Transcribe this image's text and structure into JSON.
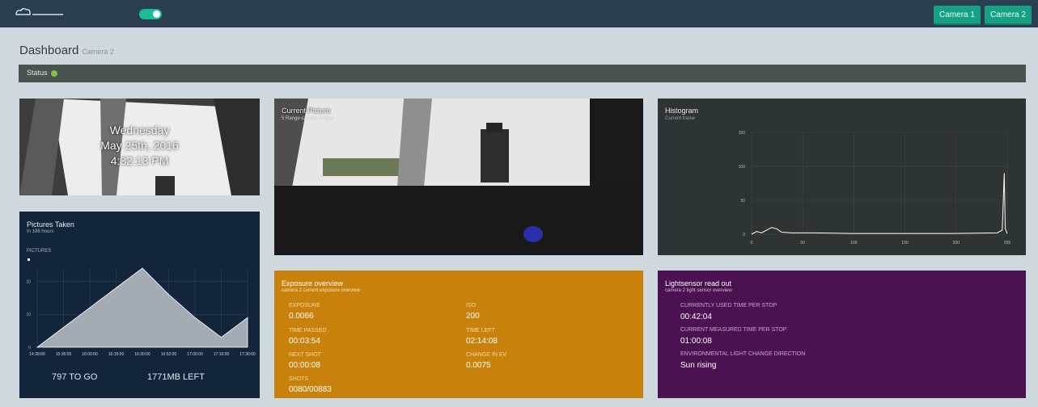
{
  "colors": {
    "topbar": "#2b3e50",
    "accent": "#1abc9c",
    "status_ok": "#7fc144",
    "exposure_bg": "#c8820c",
    "light_bg": "#4b1150",
    "pictures_bg": "#13253b",
    "histogram_bg": "#2e3333"
  },
  "header": {
    "logo_icon": "cloud-logo-icon",
    "toggle_state": "on",
    "camera1_label": "Camera 1",
    "camera2_label": "Camera 2"
  },
  "page": {
    "title": "Dashboard",
    "subtitle": "Camera 2"
  },
  "status": {
    "label": "Status"
  },
  "clock": {
    "day": "Wednesday",
    "date": "May 25th, 2016",
    "time": "4:32:13 PM"
  },
  "pictures": {
    "title": "Pictures Taken",
    "subtitle": "In 186 hours",
    "legend": "PICTURES",
    "remaining": "797 TO GO",
    "disk": "1771MB LEFT",
    "chart_data": {
      "type": "area",
      "x": [
        "14:28:00",
        "15:35:00",
        "16:00:00",
        "16:15:00",
        "16:30:00",
        "16:52:00",
        "17:00:00",
        "17:16:00",
        "17:30:00"
      ],
      "values": [
        0,
        6,
        12,
        18,
        24,
        16,
        9,
        3,
        9
      ],
      "ylim": [
        0,
        24
      ],
      "y_ticks": [
        0,
        10,
        20
      ],
      "grid": true
    }
  },
  "current_picture": {
    "title": "Current Picture",
    "subtitle": "5 Range camera display"
  },
  "histogram": {
    "title": "Histogram",
    "subtitle": "Current frame",
    "chart_data": {
      "type": "line",
      "x_ticks": [
        "0",
        "50",
        "100",
        "150",
        "200",
        "255"
      ],
      "y_ticks": [
        "0",
        "50",
        "100",
        "150"
      ],
      "ylim": [
        0,
        150
      ],
      "xlim": [
        0,
        255
      ],
      "grid": true,
      "x": [
        0,
        5,
        10,
        15,
        20,
        25,
        30,
        40,
        60,
        100,
        150,
        200,
        245,
        250,
        252,
        253,
        255
      ],
      "values": [
        0,
        4,
        2,
        6,
        10,
        8,
        3,
        2,
        2,
        1,
        1,
        1,
        2,
        6,
        90,
        8,
        1
      ]
    }
  },
  "exposure": {
    "title": "Exposure overview",
    "subtitle": "camera 2 current exposure overview",
    "items": [
      {
        "label": "EXPOSURE",
        "value": "0.0066"
      },
      {
        "label": "ISO",
        "value": "200"
      },
      {
        "label": "TIME PASSED",
        "value": "00:03:54"
      },
      {
        "label": "TIME LEFT",
        "value": "02:14:08"
      },
      {
        "label": "NEXT SHOT",
        "value": "00:00:08"
      },
      {
        "label": "CHANGE IN EV",
        "value": "0.0075"
      },
      {
        "label": "SHOTS",
        "value": "0080/00883"
      }
    ]
  },
  "lightsensor": {
    "title": "Lightsensor read out",
    "subtitle": "camera 2 light sensor overview",
    "items": [
      {
        "label": "CURRENTLY USED TIME PER STOP",
        "value": "00:42:04"
      },
      {
        "label": "CURRENT MEASURED TIME PER STOP",
        "value": "01:00:08"
      },
      {
        "label": "ENVIRONMENTAL LIGHT CHANGE DIRECTION",
        "value": "Sun rising"
      }
    ]
  }
}
